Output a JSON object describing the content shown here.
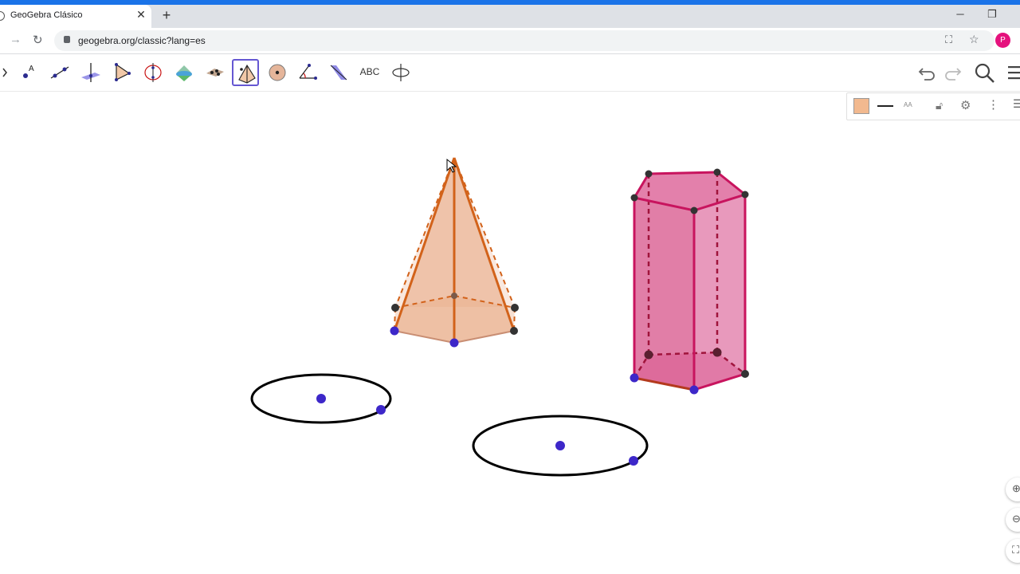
{
  "browser": {
    "tab_title": "GeoGebra Clásico",
    "tab_close": "✕",
    "new_tab": "+",
    "url": "geogebra.org/classic?lang=es",
    "profile_initial": "P",
    "window_buttons": {
      "minimize": "─",
      "restore": "❐"
    }
  },
  "toolbar": {
    "tools": [
      {
        "name": "move"
      },
      {
        "name": "point"
      },
      {
        "name": "line"
      },
      {
        "name": "perpendicular-line"
      },
      {
        "name": "polygon"
      },
      {
        "name": "circle-axis"
      },
      {
        "name": "intersect"
      },
      {
        "name": "plane"
      },
      {
        "name": "pyramid",
        "active": true
      },
      {
        "name": "sphere"
      },
      {
        "name": "angle"
      },
      {
        "name": "reflect"
      },
      {
        "name": "text",
        "label": "ABC"
      },
      {
        "name": "rotate-view"
      }
    ],
    "undo_icon": "undo-icon",
    "redo_icon": "redo-icon"
  },
  "style_bar": {
    "color": "#f2b98f",
    "label_style": "AA"
  },
  "colors": {
    "pyramid_fill": "#e8a57f",
    "pyramid_edge": "#d2621a",
    "prism_fill": "#d9558f",
    "prism_edge": "#c8145e",
    "point_blue": "#3d27c9",
    "point_dark": "#333333"
  }
}
